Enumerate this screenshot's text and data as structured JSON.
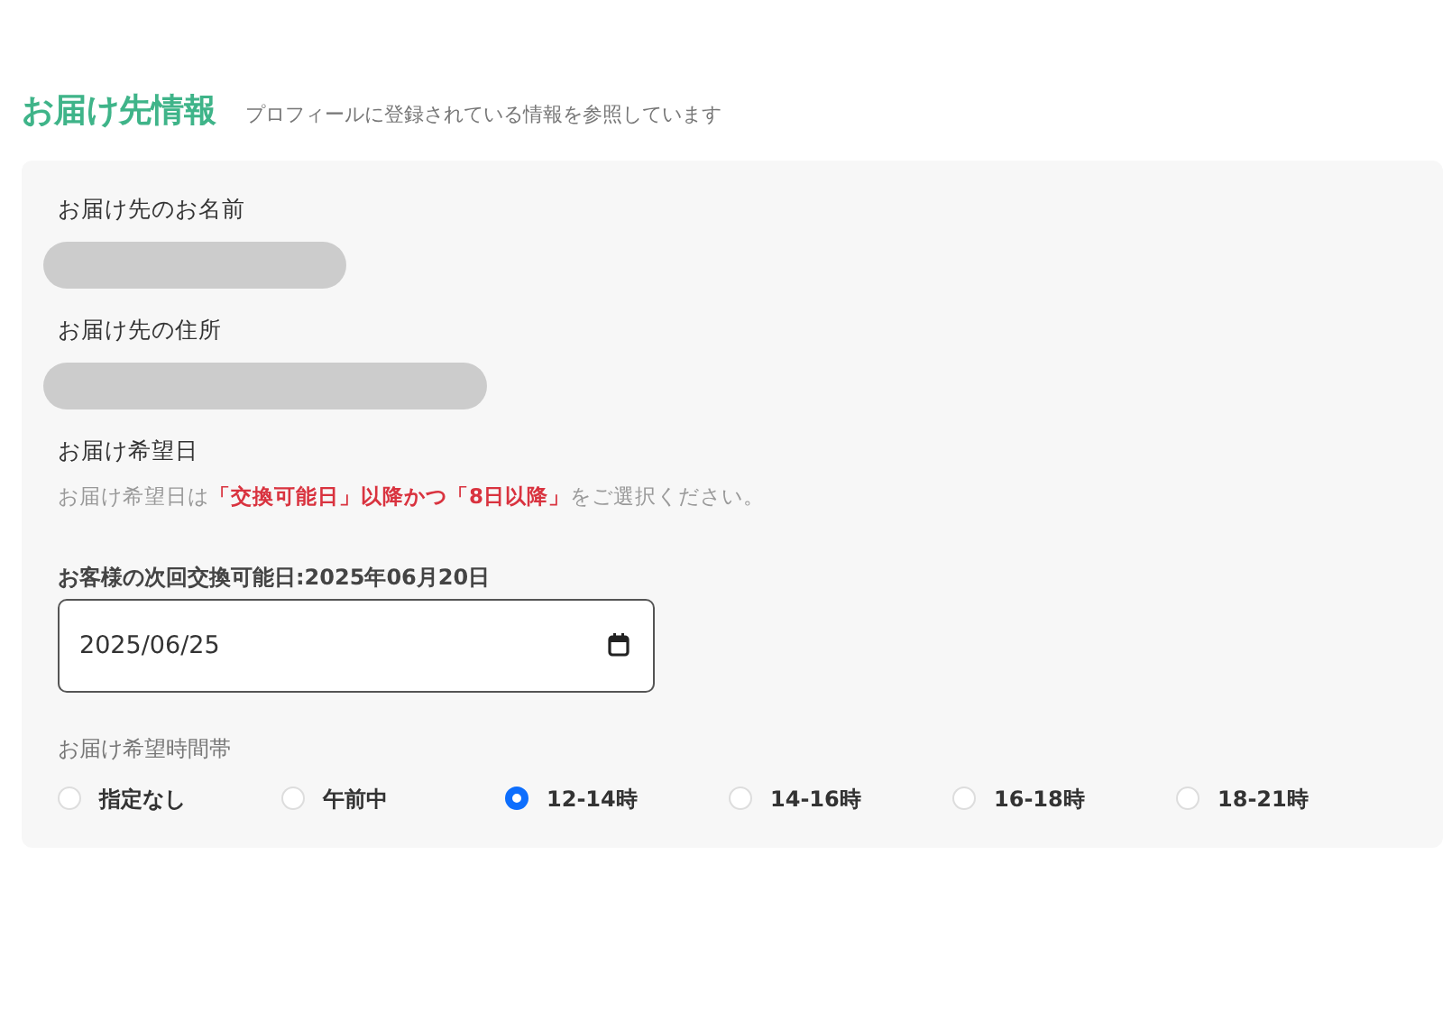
{
  "heading": {
    "title": "お届け先情報",
    "subtitle": "プロフィールに登録されている情報を参照しています"
  },
  "fields": [
    {
      "kind": "redacted",
      "label": "お届け先のお名前"
    },
    {
      "kind": "redacted",
      "label": "お届け先の住所"
    }
  ],
  "delivery_date": {
    "label": "お届け希望日",
    "note": "お届け希望日は**「交換可能日」以降かつ「8日以降」**をご選択ください。",
    "next_date_label": "お客様の次回交換可能日:2025年06月20日",
    "value": "2025/06/25"
  },
  "time_slot": {
    "label": "お届け希望時間帯",
    "options": [
      {
        "label": "指定なし",
        "selected": false
      },
      {
        "label": "午前中",
        "selected": false
      },
      {
        "label": "12-14時",
        "selected": true
      },
      {
        "label": "14-16時",
        "selected": false
      },
      {
        "label": "16-18時",
        "selected": false
      },
      {
        "label": "18-21時",
        "selected": false
      }
    ]
  }
}
